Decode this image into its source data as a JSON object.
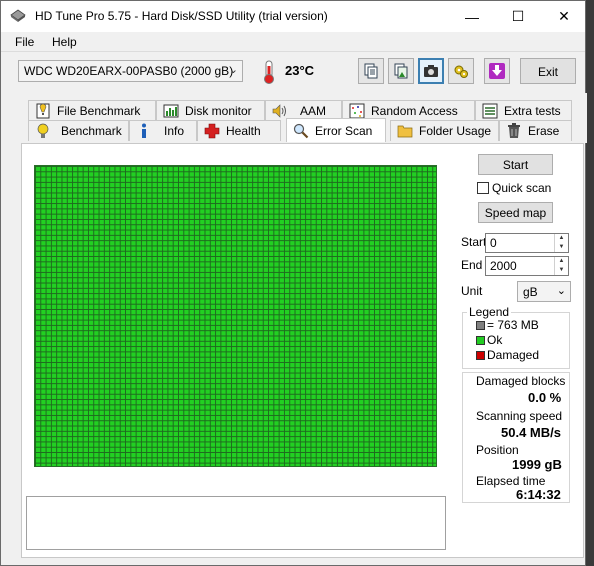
{
  "window": {
    "title": "HD Tune Pro 5.75 - Hard Disk/SSD Utility (trial version)",
    "minimize_glyph": "—",
    "maximize_glyph": "☐",
    "close_glyph": "✕"
  },
  "menu": {
    "file": "File",
    "help": "Help"
  },
  "toolbar": {
    "drive": "WDC WD20EARX-00PASB0 (2000 gB)",
    "temperature": "23°C",
    "exit_label": "Exit",
    "icons": [
      "copy-text-icon",
      "copy-image-icon",
      "screenshot-camera-icon",
      "settings-icon",
      "download-arrow-icon"
    ]
  },
  "tabs_top": [
    {
      "label": "File Benchmark",
      "icon": "file-benchmark-icon"
    },
    {
      "label": "Disk monitor",
      "icon": "disk-monitor-icon"
    },
    {
      "label": "AAM",
      "icon": "speaker-icon"
    },
    {
      "label": "Random Access",
      "icon": "random-access-icon"
    },
    {
      "label": "Extra tests",
      "icon": "extra-tests-icon"
    }
  ],
  "tabs_bottom": [
    {
      "label": "Benchmark",
      "icon": "benchmark-bulb-icon"
    },
    {
      "label": "Info",
      "icon": "info-icon"
    },
    {
      "label": "Health",
      "icon": "health-cross-icon"
    },
    {
      "label": "Error Scan",
      "icon": "magnifier-icon",
      "active": true
    },
    {
      "label": "Folder Usage",
      "icon": "folder-icon"
    },
    {
      "label": "Erase",
      "icon": "trash-icon"
    }
  ],
  "controls": {
    "start_button": "Start",
    "quick_scan": "Quick scan",
    "quick_scan_checked": false,
    "speed_map_button": "Speed map",
    "start_label": "Start",
    "start_value": "0",
    "end_label": "End",
    "end_value": "2000",
    "unit_label": "Unit",
    "unit_value": "gB"
  },
  "legend": {
    "title": "Legend",
    "items": [
      {
        "label": "= 763 MB",
        "color": "#808080"
      },
      {
        "label": "Ok",
        "color": "#22cc22"
      },
      {
        "label": "Damaged",
        "color": "#cc0000"
      }
    ]
  },
  "stats": {
    "damaged_label": "Damaged blocks",
    "damaged_value": "0.0 %",
    "speed_label": "Scanning speed",
    "speed_value": "50.4 MB/s",
    "position_label": "Position",
    "position_value": "1999 gB",
    "elapsed_label": "Elapsed time",
    "elapsed_value": "6:14:32"
  },
  "colors": {
    "ok_block": "#22d022",
    "grid_line": "#1f6a1f",
    "accent": "#3c7fb1"
  }
}
